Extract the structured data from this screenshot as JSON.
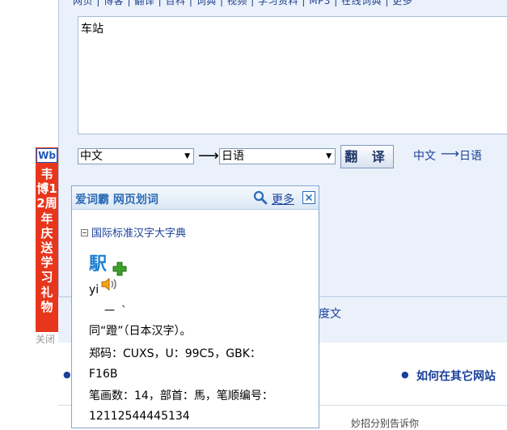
{
  "top_nav": "网页 | 博客 | 翻译 | 百科 | 词典 | 视频 | 学习资料 | MP3 | 在线词典 | 更多",
  "source_text": "车站",
  "from_lang": "中文",
  "to_lang": "日语",
  "translate_label": "翻 译",
  "quick_pair": {
    "from": "中文",
    "arrow": "⟶",
    "to": "日语"
  },
  "direction_arrow": "⟶",
  "banner": {
    "logo": "Wb",
    "text": "韦博12周年庆送学习礼物",
    "close": "关闭"
  },
  "popup": {
    "title": "爱词霸 网页划词",
    "more": "更多",
    "section": "国际标准汉字大字典",
    "headword": "駅",
    "pinyin": "yi",
    "strokes": "一 `",
    "lines": [
      "同“蹬”（日本汉字）。",
      "郑码：CUXS，U：99C5，GBK：",
      "F16B",
      "笔画数：14，部首：馬，笔顺编号：",
      "12112544445134"
    ]
  },
  "behind_text": "度文",
  "behind_bottom": "妙招分别告诉你",
  "howto_link": "如何在其它网站",
  "colors": {
    "link": "#1a3f9a",
    "banner": "#e8361d",
    "headword": "#1c7fd0"
  }
}
